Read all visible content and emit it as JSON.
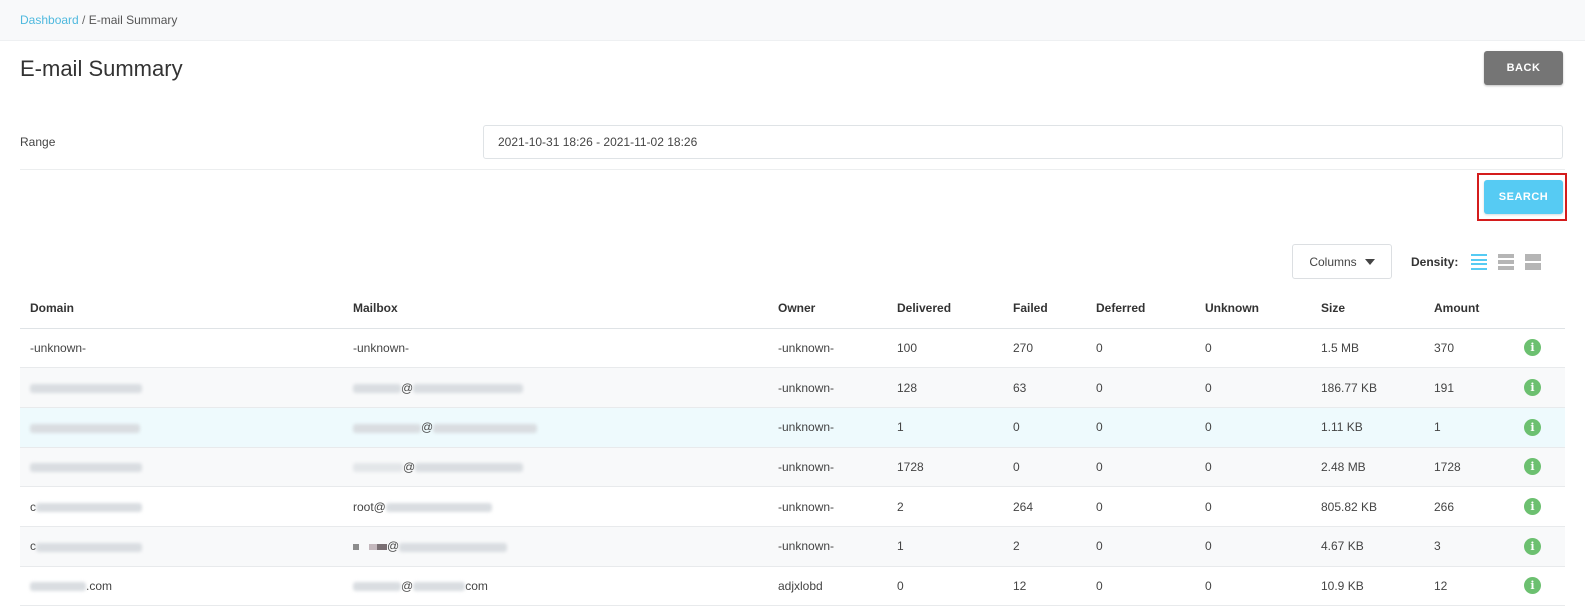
{
  "breadcrumb": {
    "home": "Dashboard",
    "separator": " / ",
    "current": "E-mail Summary"
  },
  "page_title": "E-mail Summary",
  "back_button": "BACK",
  "range": {
    "label": "Range",
    "value": "2021-10-31 18:26 - 2021-11-02 18:26"
  },
  "search_button": "SEARCH",
  "toolbar": {
    "columns_label": "Columns",
    "density_label": "Density:"
  },
  "table": {
    "columns": [
      "Domain",
      "Mailbox",
      "Owner",
      "Delivered",
      "Failed",
      "Deferred",
      "Unknown",
      "Size",
      "Amount"
    ],
    "rows": [
      {
        "domain": "-unknown-",
        "mailbox": "-unknown-",
        "owner": "-unknown-",
        "delivered": "100",
        "failed": "270",
        "deferred": "0",
        "unknown": "0",
        "size": "1.5 MB",
        "amount": "370"
      },
      {
        "domain": "",
        "mailbox": "@",
        "owner": "-unknown-",
        "delivered": "128",
        "failed": "63",
        "deferred": "0",
        "unknown": "0",
        "size": "186.77 KB",
        "amount": "191"
      },
      {
        "domain": "",
        "mailbox": "@",
        "owner": "-unknown-",
        "delivered": "1",
        "failed": "0",
        "deferred": "0",
        "unknown": "0",
        "size": "1.11 KB",
        "amount": "1"
      },
      {
        "domain": "",
        "mailbox": "@",
        "owner": "-unknown-",
        "delivered": "1728",
        "failed": "0",
        "deferred": "0",
        "unknown": "0",
        "size": "2.48 MB",
        "amount": "1728"
      },
      {
        "domain": "c",
        "mailbox": "root@",
        "owner": "-unknown-",
        "delivered": "2",
        "failed": "264",
        "deferred": "0",
        "unknown": "0",
        "size": "805.82 KB",
        "amount": "266"
      },
      {
        "domain": "c",
        "mailbox": "@",
        "owner": "-unknown-",
        "delivered": "1",
        "failed": "2",
        "deferred": "0",
        "unknown": "0",
        "size": "4.67 KB",
        "amount": "3"
      },
      {
        "domain": ".com",
        "mailbox": "@",
        "mailbox_suffix": "com",
        "owner": "adjxlobd",
        "delivered": "0",
        "failed": "12",
        "deferred": "0",
        "unknown": "0",
        "size": "10.9 KB",
        "amount": "12"
      }
    ],
    "info_glyph": "i"
  },
  "colors": {
    "accent": "#56cbf3",
    "link": "#4fb9de",
    "back_button": "#757575",
    "highlight_border": "#d41c1c",
    "info_icon": "#6cc070"
  },
  "icons": {
    "columns_dropdown": "caret-down-icon",
    "density": [
      "density-compact-icon",
      "density-standard-icon",
      "density-comfortable-icon"
    ],
    "row_info": "info-icon"
  }
}
